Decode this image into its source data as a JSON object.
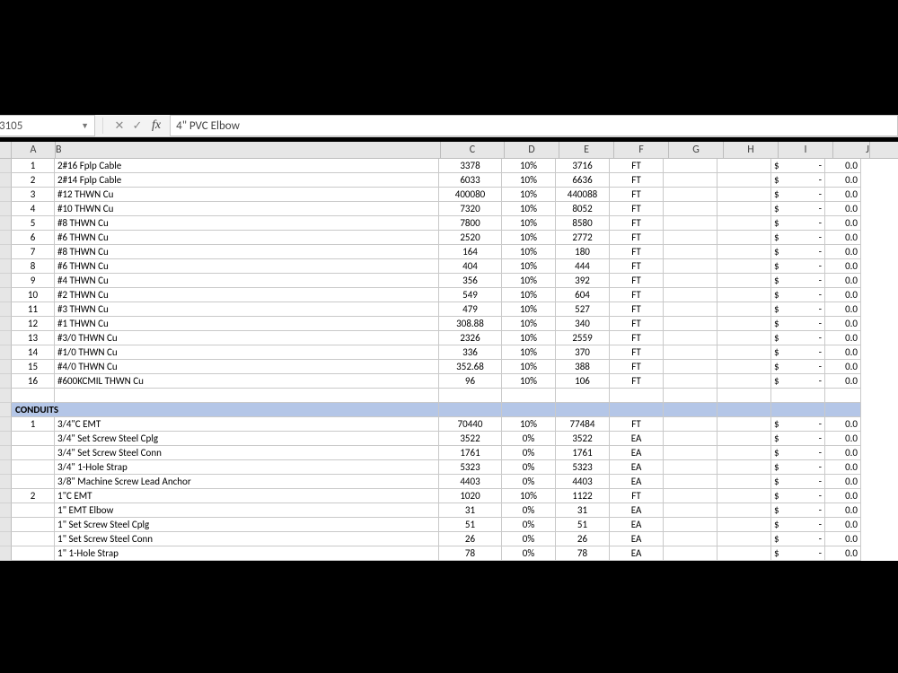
{
  "namebox": "3105",
  "formula": "4\" PVC Elbow",
  "columns": [
    "A",
    "B",
    "C",
    "D",
    "E",
    "F",
    "G",
    "H",
    "I",
    "J"
  ],
  "rows": [
    {
      "a": "1",
      "b": "2#16 Fplp Cable",
      "c": "3378",
      "d": "10%",
      "e": "3716",
      "f": "FT",
      "i": "$-",
      "j": "0.0"
    },
    {
      "a": "2",
      "b": "2#14 Fplp Cable",
      "c": "6033",
      "d": "10%",
      "e": "6636",
      "f": "FT",
      "i": "$-",
      "j": "0.0"
    },
    {
      "a": "3",
      "b": "#12 THWN Cu",
      "c": "400080",
      "d": "10%",
      "e": "440088",
      "f": "FT",
      "i": "$-",
      "j": "0.0"
    },
    {
      "a": "4",
      "b": "#10 THWN Cu",
      "c": "7320",
      "d": "10%",
      "e": "8052",
      "f": "FT",
      "i": "$-",
      "j": "0.0"
    },
    {
      "a": "5",
      "b": "#8 THWN Cu",
      "c": "7800",
      "d": "10%",
      "e": "8580",
      "f": "FT",
      "i": "$-",
      "j": "0.0"
    },
    {
      "a": "6",
      "b": "#6 THWN Cu",
      "c": "2520",
      "d": "10%",
      "e": "2772",
      "f": "FT",
      "i": "$-",
      "j": "0.0"
    },
    {
      "a": "7",
      "b": "#8 THWN Cu",
      "c": "164",
      "d": "10%",
      "e": "180",
      "f": "FT",
      "i": "$-",
      "j": "0.0"
    },
    {
      "a": "8",
      "b": "#6 THWN Cu",
      "c": "404",
      "d": "10%",
      "e": "444",
      "f": "FT",
      "i": "$-",
      "j": "0.0"
    },
    {
      "a": "9",
      "b": "#4 THWN Cu",
      "c": "356",
      "d": "10%",
      "e": "392",
      "f": "FT",
      "i": "$-",
      "j": "0.0"
    },
    {
      "a": "10",
      "b": "#2 THWN Cu",
      "c": "549",
      "d": "10%",
      "e": "604",
      "f": "FT",
      "i": "$-",
      "j": "0.0"
    },
    {
      "a": "11",
      "b": "#3 THWN Cu",
      "c": "479",
      "d": "10%",
      "e": "527",
      "f": "FT",
      "i": "$-",
      "j": "0.0"
    },
    {
      "a": "12",
      "b": "#1 THWN Cu",
      "c": "308.88",
      "d": "10%",
      "e": "340",
      "f": "FT",
      "i": "$-",
      "j": "0.0"
    },
    {
      "a": "13",
      "b": "#3/0 THWN Cu",
      "c": "2326",
      "d": "10%",
      "e": "2559",
      "f": "FT",
      "i": "$-",
      "j": "0.0"
    },
    {
      "a": "14",
      "b": "#1/0 THWN Cu",
      "c": "336",
      "d": "10%",
      "e": "370",
      "f": "FT",
      "i": "$-",
      "j": "0.0"
    },
    {
      "a": "15",
      "b": "#4/0 THWN Cu",
      "c": "352.68",
      "d": "10%",
      "e": "388",
      "f": "FT",
      "i": "$-",
      "j": "0.0"
    },
    {
      "a": "16",
      "b": "#600KCMIL THWN Cu",
      "c": "96",
      "d": "10%",
      "e": "106",
      "f": "FT",
      "i": "$-",
      "j": "0.0"
    },
    {
      "type": "blank"
    },
    {
      "type": "section",
      "b": "CONDUITS"
    },
    {
      "a": "1",
      "b": "3/4\"C EMT",
      "c": "70440",
      "d": "10%",
      "e": "77484",
      "f": "FT",
      "i": "$-",
      "j": "0.0"
    },
    {
      "a": "",
      "b": "3/4\" Set Screw Steel Cplg",
      "c": "3522",
      "d": "0%",
      "e": "3522",
      "f": "EA",
      "i": "$-",
      "j": "0.0"
    },
    {
      "a": "",
      "b": "3/4\" Set Screw Steel Conn",
      "c": "1761",
      "d": "0%",
      "e": "1761",
      "f": "EA",
      "i": "$-",
      "j": "0.0"
    },
    {
      "a": "",
      "b": "3/4\" 1-Hole Strap",
      "c": "5323",
      "d": "0%",
      "e": "5323",
      "f": "EA",
      "i": "$-",
      "j": "0.0"
    },
    {
      "a": "",
      "b": "3/8\" Machine Screw Lead Anchor",
      "c": "4403",
      "d": "0%",
      "e": "4403",
      "f": "EA",
      "i": "$-",
      "j": "0.0"
    },
    {
      "a": "2",
      "b": "1\"C EMT",
      "c": "1020",
      "d": "10%",
      "e": "1122",
      "f": "FT",
      "i": "$-",
      "j": "0.0"
    },
    {
      "a": "",
      "b": "1\" EMT Elbow",
      "c": "31",
      "d": "0%",
      "e": "31",
      "f": "EA",
      "i": "$-",
      "j": "0.0"
    },
    {
      "a": "",
      "b": "1\" Set Screw Steel Cplg",
      "c": "51",
      "d": "0%",
      "e": "51",
      "f": "EA",
      "i": "$-",
      "j": "0.0"
    },
    {
      "a": "",
      "b": "1\" Set Screw Steel Conn",
      "c": "26",
      "d": "0%",
      "e": "26",
      "f": "EA",
      "i": "$-",
      "j": "0.0"
    },
    {
      "a": "",
      "b": "1\" 1-Hole Strap",
      "c": "78",
      "d": "0%",
      "e": "78",
      "f": "EA",
      "i": "$-",
      "j": "0.0"
    }
  ],
  "labels": {
    "cancel": "✕",
    "enter": "✓",
    "fx": "fx"
  }
}
